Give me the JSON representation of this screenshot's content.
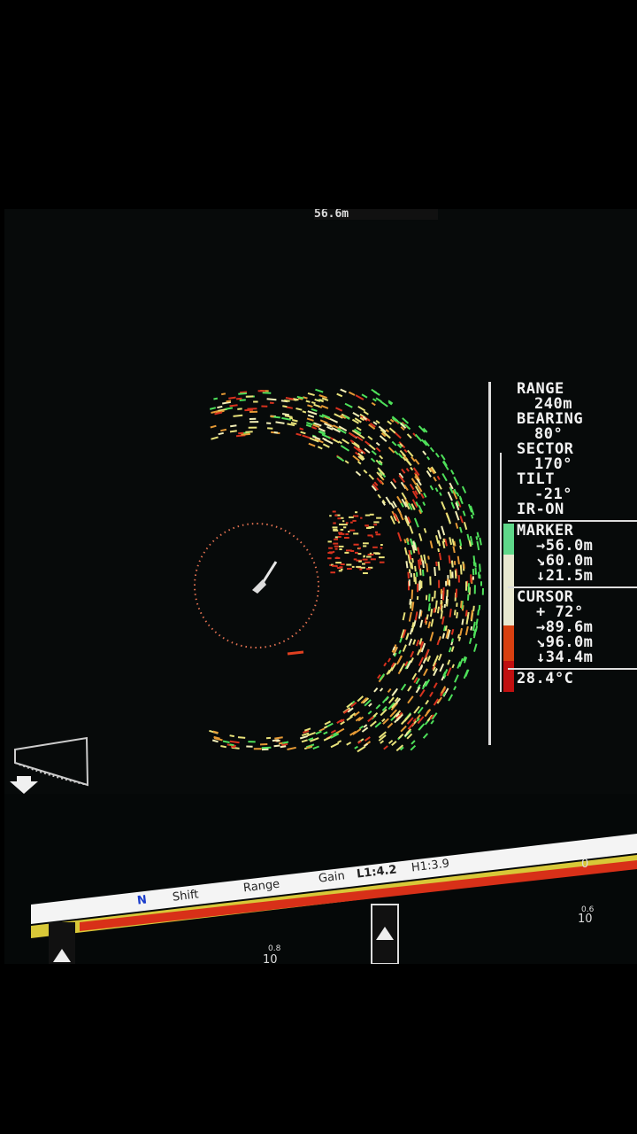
{
  "top_readout": "56.6m",
  "info_panel": {
    "range_label": "RANGE",
    "range_value": "240m",
    "bearing_label": "BEARING",
    "bearing_value": "80°",
    "sector_label": "SECTOR",
    "sector_value": "170°",
    "tilt_label": "TILT",
    "tilt_value": "-21°",
    "ir_status": "IR-ON",
    "marker_label": "MARKER",
    "marker_horizontal": "→56.0m",
    "marker_slant": "↘60.0m",
    "marker_depth": "↓21.5m",
    "cursor_label": "CURSOR",
    "cursor_bearing": "+ 72°",
    "cursor_horizontal": "→89.6m",
    "cursor_slant": "↘96.0m",
    "cursor_depth": "↓34.4m",
    "water_temp": "28.4°C"
  },
  "echogram_toolbar": {
    "north": "N",
    "shift": "Shift",
    "range": "Range",
    "gain": "Gain",
    "l1": "L1:4.2",
    "h1": "H1:3.9"
  },
  "echogram_labels": {
    "depth_left": "10",
    "depth_right": "10",
    "sub_left": "0.8",
    "sub_right": "0.6",
    "zero": "0"
  },
  "colors": {
    "background": "#070a0a",
    "echo_yellow": "#e8e27a",
    "echo_red": "#d8321e",
    "echo_green": "#4ee05a",
    "text": "#f2f2f2"
  },
  "icons": [
    "ship-icon",
    "range-ring",
    "down-arrow-icon",
    "tilt-indicator"
  ]
}
